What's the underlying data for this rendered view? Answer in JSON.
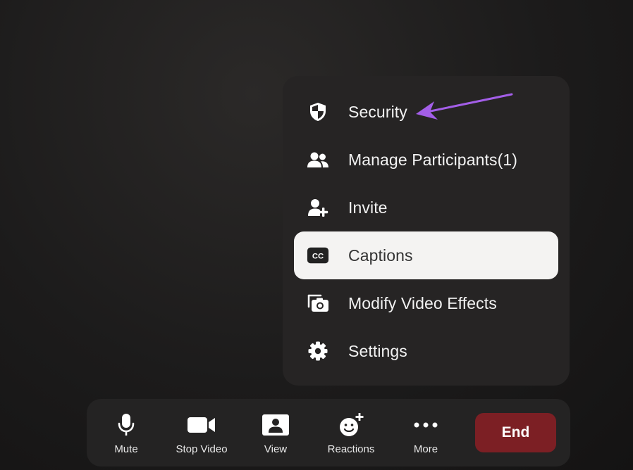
{
  "menu": {
    "items": [
      {
        "label": "Security",
        "icon": "shield-icon"
      },
      {
        "label": "Manage Participants(1)",
        "icon": "participants-icon"
      },
      {
        "label": "Invite",
        "icon": "add-user-icon"
      },
      {
        "label": "Captions",
        "icon": "cc-icon",
        "selected": true
      },
      {
        "label": "Modify Video Effects",
        "icon": "video-effects-icon"
      },
      {
        "label": "Settings",
        "icon": "gear-icon"
      }
    ]
  },
  "toolbar": {
    "mute_label": "Mute",
    "stop_video_label": "Stop Video",
    "view_label": "View",
    "reactions_label": "Reactions",
    "more_label": "More",
    "end_label": "End"
  },
  "colors": {
    "end_button": "#7c1f24",
    "arrow": "#a35ee8",
    "selected_item": "#f4f3f2"
  }
}
